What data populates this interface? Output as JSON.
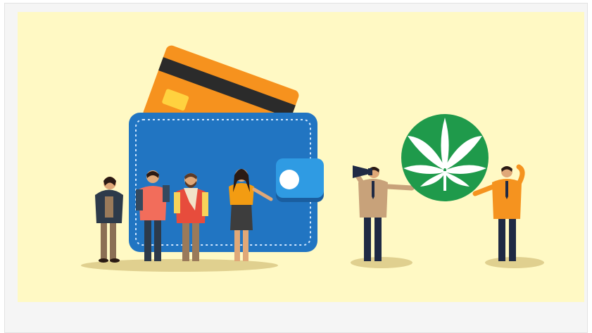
{
  "scene": {
    "subject": "wallet-with-card-people-and-cannabis-badge",
    "colors": {
      "background": "#fff9c4",
      "frame": "#f5f5f5",
      "wallet": "#2175c2",
      "wallet_clasp": "#2f9be3",
      "card": "#f6921e",
      "card_stripe": "#2b2b2b",
      "badge": "#1f9a4b",
      "leaf": "#ffffff",
      "ground_shadow": "#e0d08f"
    },
    "icons": [
      "wallet-icon",
      "credit-card-icon",
      "cannabis-leaf-icon",
      "megaphone-icon"
    ]
  }
}
